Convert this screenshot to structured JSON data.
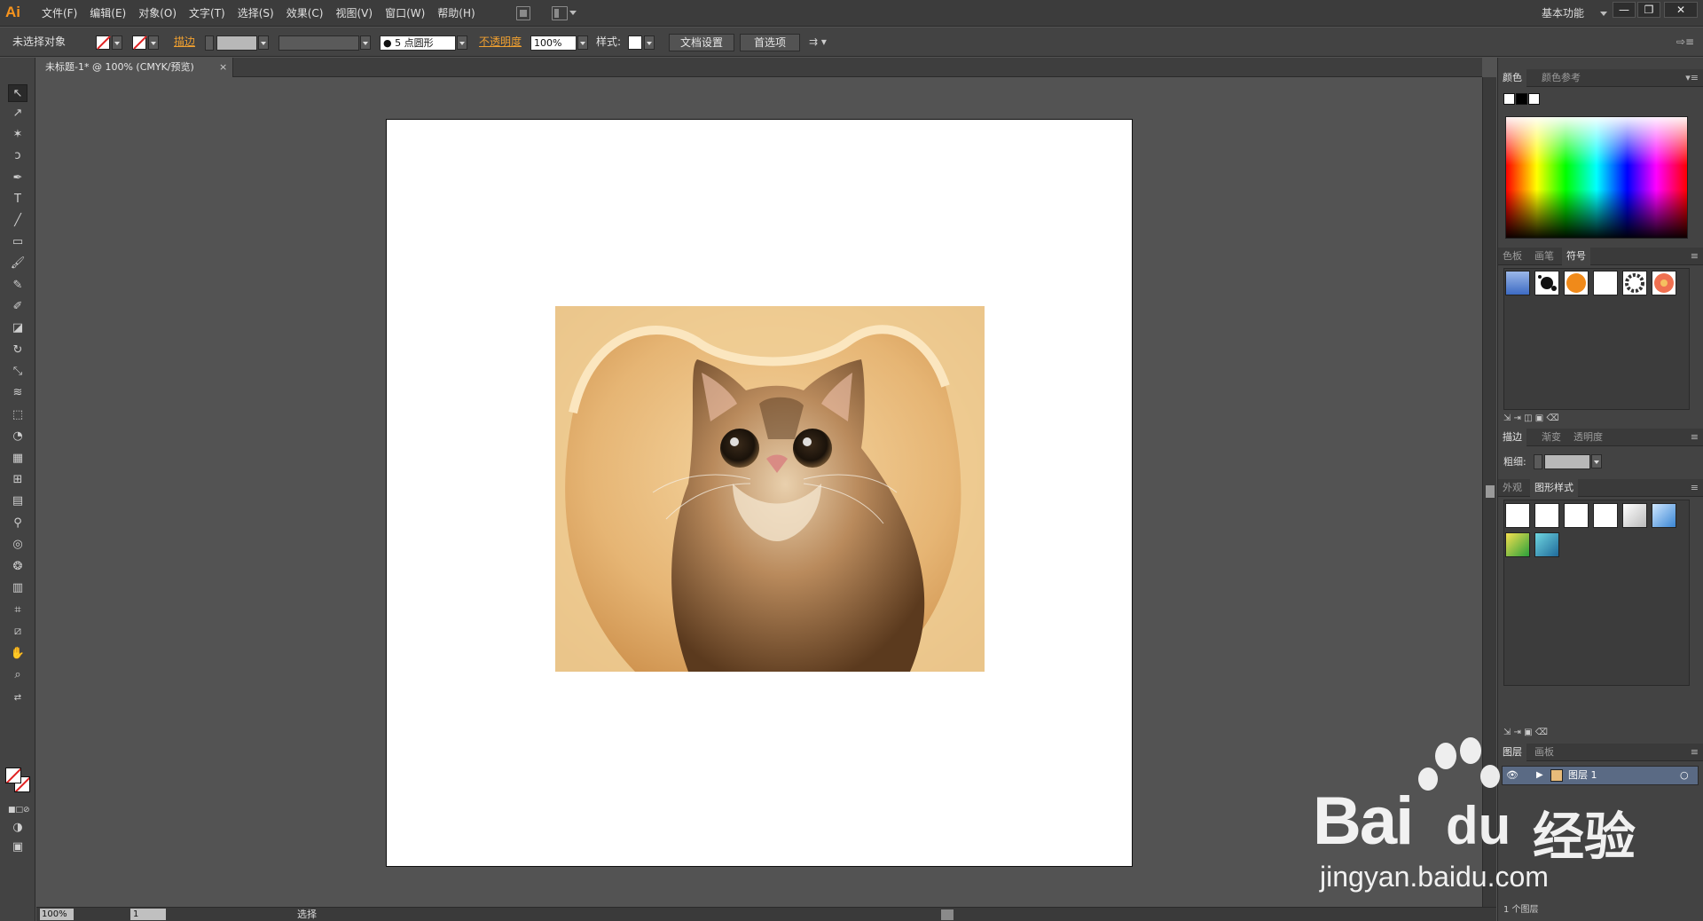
{
  "app": {
    "logo": "Ai"
  },
  "menu": [
    "文件(F)",
    "编辑(E)",
    "对象(O)",
    "文字(T)",
    "选择(S)",
    "效果(C)",
    "视图(V)",
    "窗口(W)",
    "帮助(H)"
  ],
  "workspace": {
    "label": "基本功能"
  },
  "window_buttons": [
    "—",
    "❐",
    "✕"
  ],
  "control": {
    "selection": "未选择对象",
    "stroke_label": "描边",
    "brush_size": "5 点圆形",
    "opacity_label": "不透明度",
    "opacity_value": "100%",
    "style_label": "样式:",
    "doc_setup": "文档设置",
    "preferences": "首选项"
  },
  "document": {
    "tab_title": "未标题-1* @ 100% (CMYK/预览)",
    "close": "×"
  },
  "status": {
    "zoom": "100%",
    "page": "1",
    "tool": "选择"
  },
  "panels": {
    "color": {
      "tabs": [
        "颜色",
        "颜色参考"
      ]
    },
    "swatches": {
      "tabs": [
        "色板",
        "画笔",
        "符号"
      ]
    },
    "stroke": {
      "tabs": [
        "描边",
        "渐变",
        "透明度"
      ],
      "weight_label": "粗细:"
    },
    "graphic_styles": {
      "tabs": [
        "外观",
        "图形样式"
      ]
    },
    "layers": {
      "tabs": [
        "图层",
        "画板"
      ],
      "layer_name": "图层 1",
      "count": "1 个图层"
    }
  },
  "watermark": {
    "brand": "Bai",
    "brand_cn": "经验",
    "url": "jingyan.baidu.com"
  },
  "colors": {
    "accent": "#f7941d",
    "panel_bg": "#434343",
    "canvas_bg": "#535353",
    "artboard": "#ffffff"
  }
}
